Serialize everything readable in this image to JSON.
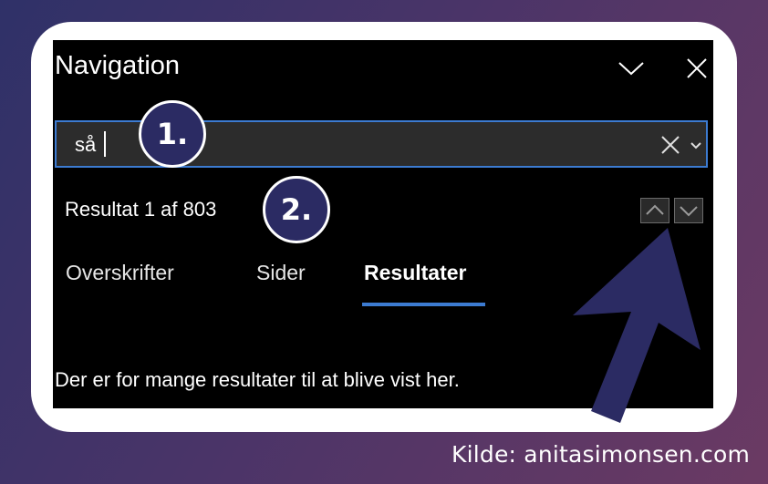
{
  "navigation_pane": {
    "title": "Navigation",
    "collapse_icon": "chevron-down-icon",
    "close_icon": "close-icon"
  },
  "search": {
    "value": "så",
    "clear_icon": "close-icon",
    "dropdown_icon": "chevron-down-icon"
  },
  "results": {
    "count_text": "Resultat 1 af 803",
    "previous_icon": "chevron-up-icon",
    "next_icon": "chevron-down-icon"
  },
  "tabs": [
    {
      "label": "Overskrifter",
      "active": false
    },
    {
      "label": "Sider",
      "active": false
    },
    {
      "label": "Resultater",
      "active": true
    }
  ],
  "message": "Der er for mange resultater til at blive vist her.",
  "annotations": {
    "marker_1": "1.",
    "marker_2": "2.",
    "arrow_icon": "pointer-arrow-icon"
  },
  "credit": "Kilde: anitasimonsen.com",
  "colors": {
    "accent": "#3c7bd1",
    "marker_fill": "#2b2b63",
    "pane_background": "#000000"
  }
}
